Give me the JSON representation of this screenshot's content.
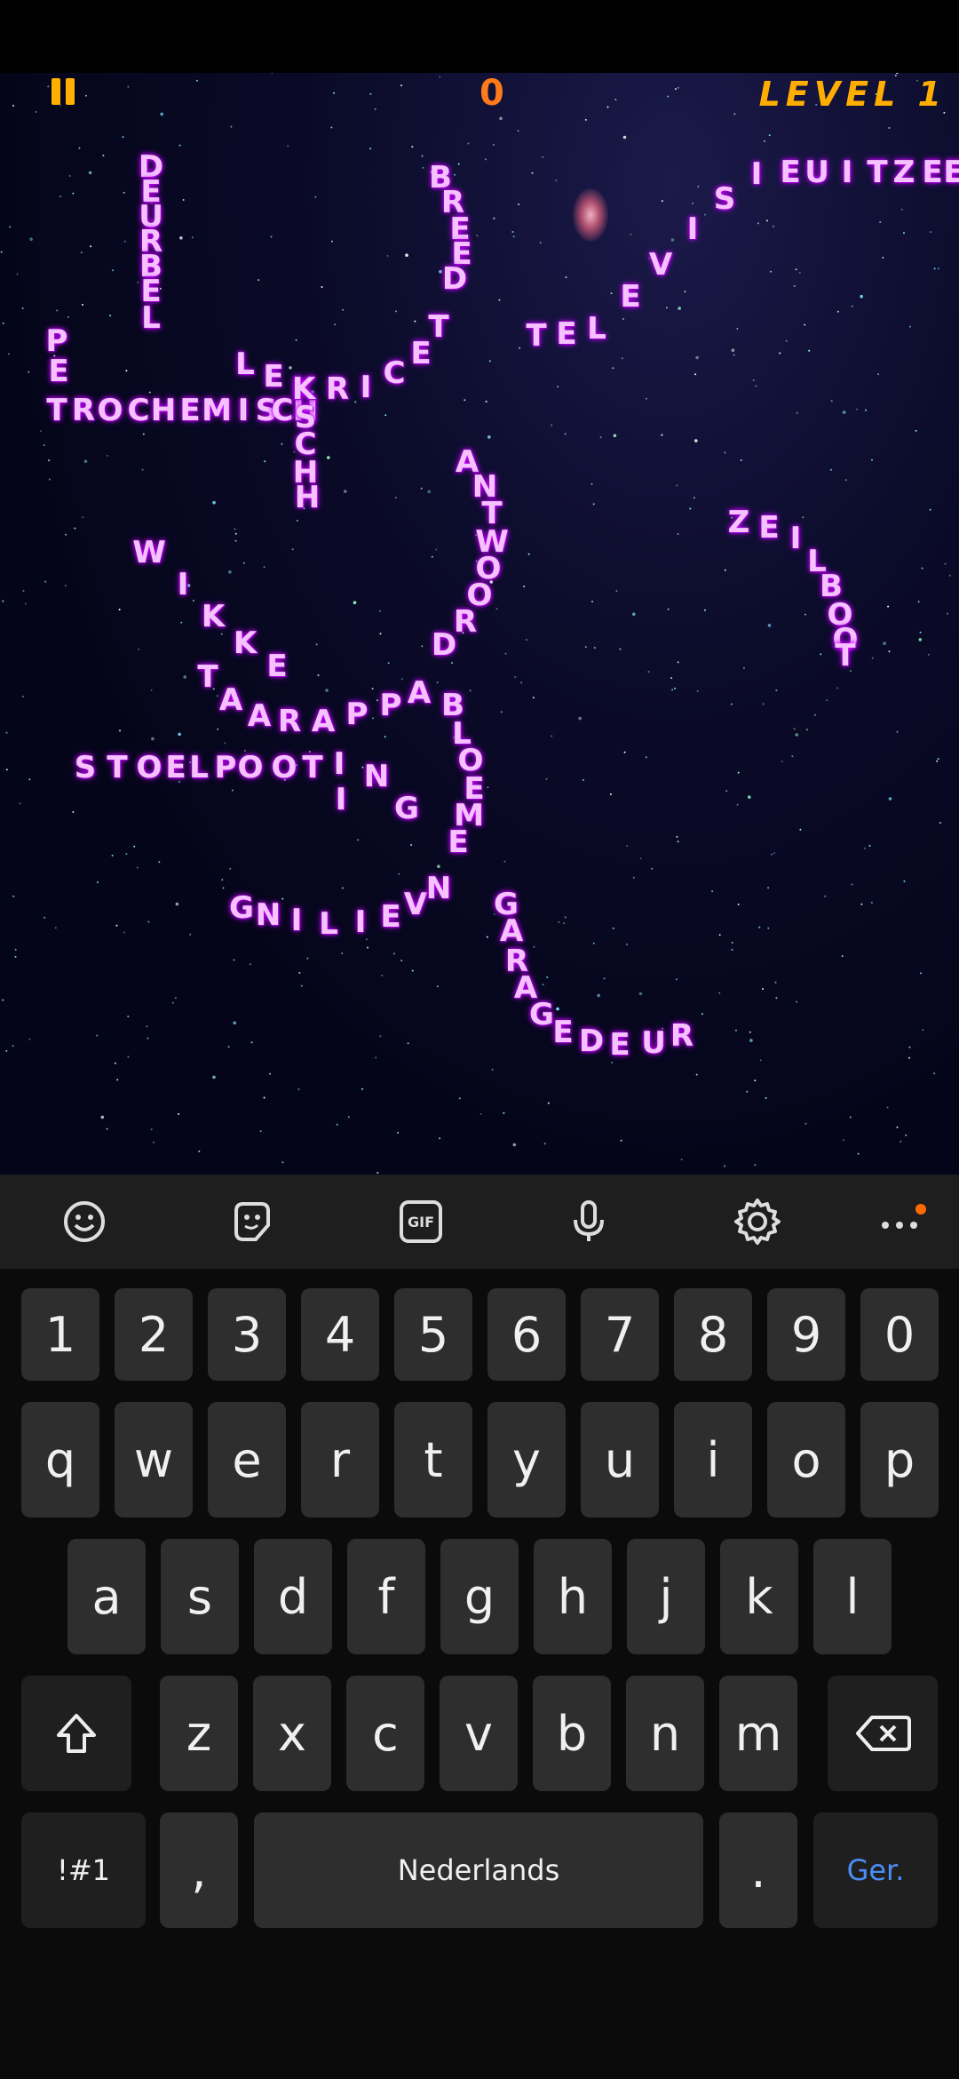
{
  "hud": {
    "score": "0",
    "level": "LEVEL 1"
  },
  "words": [
    "DEURBEL",
    "BREED",
    "TELEVISIE",
    "PETROCHEMISCH",
    "LEKRICE",
    "KICH",
    "ANTWOORD",
    "ZEILBOOT",
    "WIKKE",
    "TAARAPPA",
    "STOELPOOT",
    "BLOEME",
    "GNILIEV",
    "GARAGEDEUR"
  ],
  "toolbar": {
    "gif_label": "GIF",
    "icons": [
      "emoji-icon",
      "sticker-icon",
      "gif-icon",
      "mic-icon",
      "gear-icon",
      "more-icon"
    ]
  },
  "keyboard": {
    "row_numbers": [
      "1",
      "2",
      "3",
      "4",
      "5",
      "6",
      "7",
      "8",
      "9",
      "0"
    ],
    "row1": [
      "q",
      "w",
      "e",
      "r",
      "t",
      "y",
      "u",
      "i",
      "o",
      "p"
    ],
    "row2": [
      "a",
      "s",
      "d",
      "f",
      "g",
      "h",
      "j",
      "k",
      "l"
    ],
    "row3": [
      "z",
      "x",
      "c",
      "v",
      "b",
      "n",
      "m"
    ],
    "symbols": "!#1",
    "comma": ",",
    "space": "Nederlands",
    "period": ".",
    "go": "Ger."
  },
  "colors": {
    "accent_go": "#4c8df6",
    "notification_dot": "#ff6a00",
    "letter_glow": "#d000ff"
  }
}
